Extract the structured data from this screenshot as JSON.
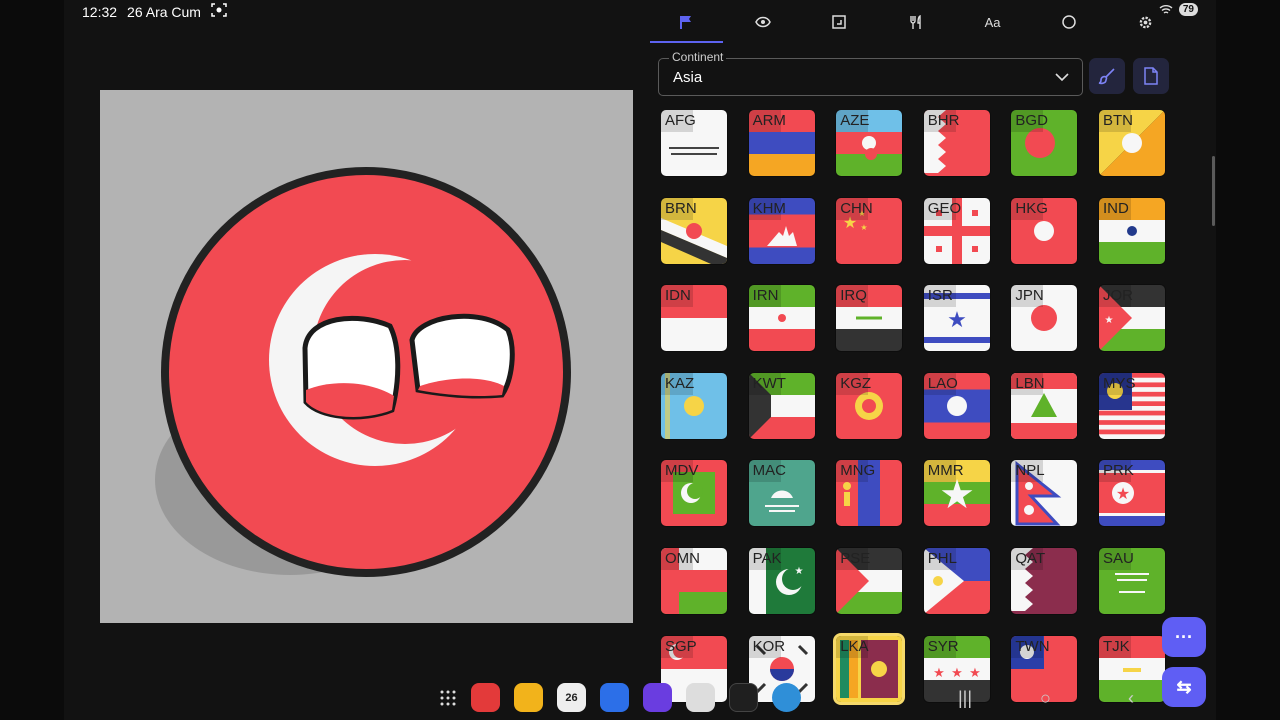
{
  "status": {
    "time": "12:32",
    "date": "26 Ara Cum",
    "battery": "79"
  },
  "tabs": [
    {
      "icon": "flag-icon",
      "active": true
    },
    {
      "icon": "eye-icon"
    },
    {
      "icon": "frame-icon"
    },
    {
      "icon": "fork-knife-icon"
    },
    {
      "icon": "font-icon",
      "label": "Aa"
    },
    {
      "icon": "circle-icon"
    },
    {
      "icon": "gear-icon"
    }
  ],
  "continent": {
    "label": "Continent",
    "value": "Asia"
  },
  "toolbar": {
    "brush_icon": "brush-icon",
    "file_icon": "file-icon"
  },
  "accent": "#5d63f0",
  "flags": [
    "AFG",
    "ARM",
    "AZE",
    "BHR",
    "BGD",
    "BTN",
    "BRN",
    "KHM",
    "CHN",
    "GEO",
    "HKG",
    "IND",
    "IDN",
    "IRN",
    "IRQ",
    "ISR",
    "JPN",
    "JOR",
    "KAZ",
    "KWT",
    "KGZ",
    "LAO",
    "LBN",
    "MYS",
    "MDV",
    "MAC",
    "MNG",
    "MMR",
    "NPL",
    "PRK",
    "OMN",
    "PAK",
    "PSE",
    "PHL",
    "QAT",
    "SAU",
    "SGP",
    "KOR",
    "LKA",
    "SYR",
    "TWN",
    "TJK"
  ],
  "selected_flag": "LKA",
  "fab": {
    "more": "···",
    "swap": "⇆"
  },
  "dock": {
    "calendar_day": "26"
  },
  "nav": {
    "recents": "|||",
    "home": "○",
    "back": "‹"
  }
}
